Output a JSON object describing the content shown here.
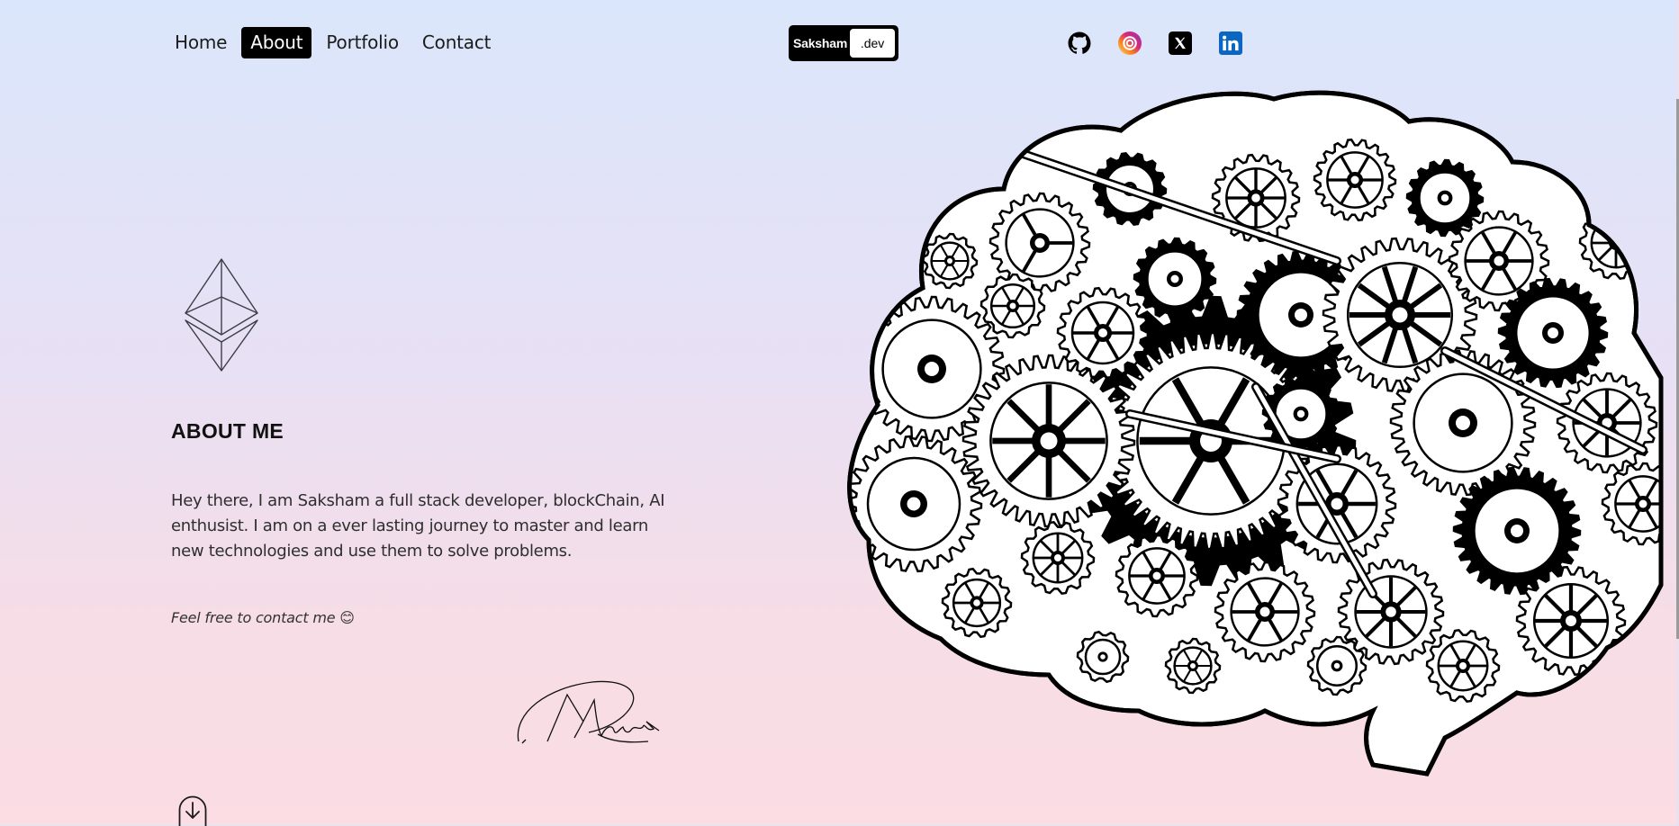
{
  "nav": {
    "items": [
      {
        "label": "Home",
        "active": false
      },
      {
        "label": "About",
        "active": true
      },
      {
        "label": "Portfolio",
        "active": false
      },
      {
        "label": "Contact",
        "active": false
      }
    ]
  },
  "logo": {
    "name": "Saksham",
    "suffix": ".dev"
  },
  "social": [
    {
      "icon": "github-icon",
      "color": "#000000"
    },
    {
      "icon": "instagram-icon",
      "color": "#d62ad6"
    },
    {
      "icon": "x-twitter-icon",
      "color": "#000000"
    },
    {
      "icon": "linkedin-icon",
      "color": "#0a66c2"
    }
  ],
  "about": {
    "title": "ABOUT ME",
    "text": "Hey there, I am Saksham a full stack developer, blockChain, AI enthusist. I am on a ever lasting journey to master and learn new technologies and use them to solve problems.",
    "cta": "Feel free to contact me 😊"
  },
  "colors": {
    "bg_top": "#dae6fb",
    "bg_bottom": "#fbdde3",
    "accent": "#000000"
  }
}
